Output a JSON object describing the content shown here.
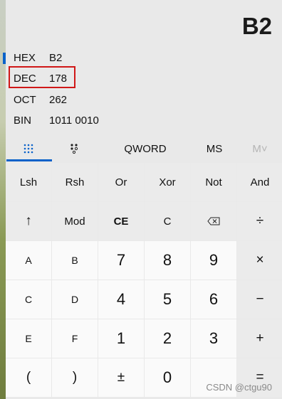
{
  "display": {
    "value": "B2"
  },
  "radix": [
    {
      "name": "HEX",
      "value": "B2"
    },
    {
      "name": "DEC",
      "value": "178"
    },
    {
      "name": "OCT",
      "value": "262"
    },
    {
      "name": "BIN",
      "value": "1011 0010"
    }
  ],
  "tabs": {
    "qword": "QWORD",
    "ms": "MS",
    "mplus": "M˅"
  },
  "keys": [
    [
      "Lsh",
      "Rsh",
      "Or",
      "Xor",
      "Not",
      "And"
    ],
    [
      "↑",
      "Mod",
      "CE",
      "C",
      "⌫",
      "÷"
    ],
    [
      "A",
      "B",
      "7",
      "8",
      "9",
      "×"
    ],
    [
      "C",
      "D",
      "4",
      "5",
      "6",
      "−"
    ],
    [
      "E",
      "F",
      "1",
      "2",
      "3",
      "+"
    ],
    [
      "(",
      ")",
      "±",
      "0",
      "",
      "="
    ]
  ],
  "colors": {
    "accent": "#0a62c9",
    "highlight": "#d01717"
  },
  "watermark": "CSDN @ctgu90"
}
